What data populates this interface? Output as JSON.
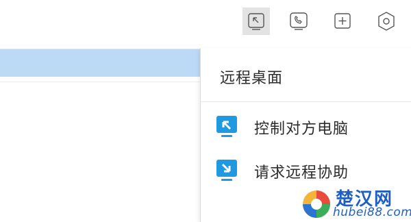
{
  "toolbar": {
    "buttons": [
      {
        "name": "remote-desktop",
        "icon": "arrow-up-left-screen-icon",
        "active": true
      },
      {
        "name": "call",
        "icon": "phone-icon",
        "active": false
      },
      {
        "name": "add",
        "icon": "plus-box-icon",
        "active": false
      },
      {
        "name": "settings",
        "icon": "hexagon-gear-icon",
        "active": false
      }
    ]
  },
  "menu": {
    "title": "远程桌面",
    "items": [
      {
        "label": "控制对方电脑",
        "icon": "remote-control-icon"
      },
      {
        "label": "请求远程协助",
        "icon": "request-assist-icon"
      }
    ]
  },
  "watermark": {
    "title": "楚汉网",
    "url": "hubei88.com"
  },
  "colors": {
    "accent": "#1f9ae0",
    "selection": "#bcd9f6",
    "active_button_bg": "#e3e3e3",
    "watermark": "#1d5fc4"
  }
}
